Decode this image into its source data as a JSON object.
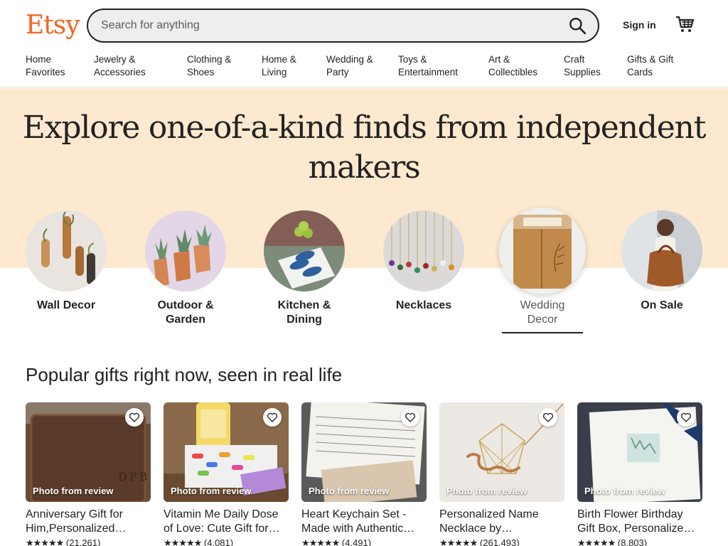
{
  "header": {
    "logo": "Etsy",
    "search_placeholder": "Search for anything",
    "signin_label": "Sign in",
    "brand_color": "#f1641e"
  },
  "nav": [
    "Home\nFavorites",
    "Jewelry &\nAccessories",
    "Clothing &\nShoes",
    "Home &\nLiving",
    "Wedding &\nParty",
    "Toys &\nEntertainment",
    "Art &\nCollectibles",
    "Craft\nSupplies",
    "Gifts & Gift\nCards"
  ],
  "hero": {
    "title": "Explore one-of-a-kind finds from independent makers",
    "categories": [
      {
        "label": "Wall Decor"
      },
      {
        "label": "Outdoor &\nGarden"
      },
      {
        "label": "Kitchen &\nDining"
      },
      {
        "label": "Necklaces"
      },
      {
        "label": "Wedding\nDecor",
        "active": true
      },
      {
        "label": "On Sale"
      }
    ]
  },
  "popular": {
    "title": "Popular gifts right now, seen in real life",
    "items": [
      {
        "photo_label": "Photo from review",
        "title": "Anniversary Gift for\nHim,Personalized…",
        "stars": 5,
        "count": "(21,261)"
      },
      {
        "photo_label": "Photo from review",
        "title": "Vitamin Me Daily Dose\nof Love: Cute Gift for…",
        "stars": 5,
        "count": "(4,081)"
      },
      {
        "photo_label": "Photo from review",
        "title": "Heart Keychain Set -\nMade with Authentic…",
        "stars": 5,
        "count": "(4,491)"
      },
      {
        "photo_label": "Photo from review",
        "title": "Personalized Name\nNecklace by…",
        "stars": 5,
        "count": "(261,493)"
      },
      {
        "photo_label": "Photo from review",
        "title": "Birth Flower Birthday\nGift Box, Personalize…",
        "stars": 5,
        "count": "(8,803)"
      }
    ]
  }
}
